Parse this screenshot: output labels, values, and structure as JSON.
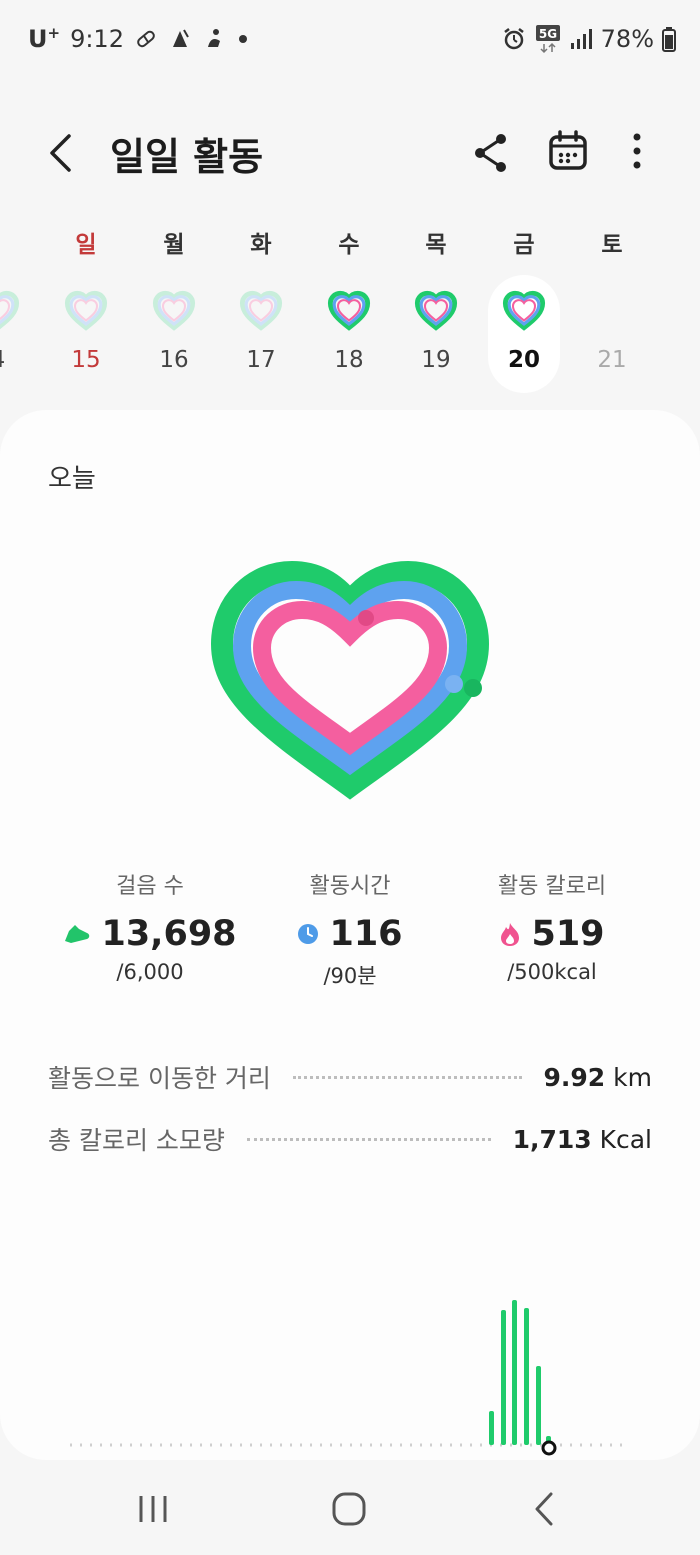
{
  "status_bar": {
    "carrier": "U",
    "carrier_sup": "+",
    "time": "9:12",
    "net_badge": "5G",
    "battery": "78%"
  },
  "app_bar": {
    "title": "일일 활동",
    "icons": [
      "back-icon",
      "share-icon",
      "calendar-icon",
      "more-icon"
    ]
  },
  "week": {
    "weekdays": [
      "일",
      "월",
      "화",
      "수",
      "목",
      "금",
      "토"
    ],
    "days": [
      {
        "num": "4",
        "status": "faded"
      },
      {
        "num": "15",
        "status": "faded"
      },
      {
        "num": "16",
        "status": "faded"
      },
      {
        "num": "17",
        "status": "faded"
      },
      {
        "num": "18",
        "status": "complete"
      },
      {
        "num": "19",
        "status": "complete"
      },
      {
        "num": "20",
        "status": "complete",
        "selected": true
      },
      {
        "num": "21",
        "status": "future"
      }
    ]
  },
  "today": {
    "label": "오늘"
  },
  "stats": {
    "steps": {
      "label": "걸음 수",
      "value": "13,698",
      "goal": "/6,000",
      "icon": "shoe-icon",
      "color": "#22c46a"
    },
    "active_time": {
      "label": "활동시간",
      "value": "116",
      "goal": "/90분",
      "icon": "clock-icon",
      "color": "#4e9be8"
    },
    "calories": {
      "label": "활동 칼로리",
      "value": "519",
      "goal": "/500kcal",
      "icon": "flame-icon",
      "color": "#f0538f"
    }
  },
  "rings": {
    "steps_progress": 2.28,
    "time_progress": 1.29,
    "calorie_progress": 1.04,
    "colors": {
      "outer": "#1fcb6b",
      "middle": "#5ea2ef",
      "inner": "#f45f9f"
    }
  },
  "distance": {
    "label": "활동으로 이동한 거리",
    "value": "9.92",
    "unit": "km"
  },
  "total_calories": {
    "label": "총 칼로리 소모량",
    "value": "1,713",
    "unit": "Kcal"
  },
  "nav": {
    "icons": [
      "recents-icon",
      "home-icon",
      "back-nav-icon"
    ]
  },
  "colors": {
    "accent_green": "#1fcb6b",
    "sunday_red": "#c33a3a"
  }
}
